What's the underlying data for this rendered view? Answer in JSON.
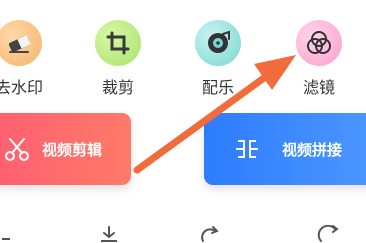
{
  "tools": [
    {
      "label": "去水印",
      "icon": "eraser-icon",
      "color": "#f6b26b"
    },
    {
      "label": "裁剪",
      "icon": "crop-icon",
      "color": "#a6e36b"
    },
    {
      "label": "配乐",
      "icon": "music-disc-icon",
      "color": "#77d7d0"
    },
    {
      "label": "滤镜",
      "icon": "filter-icon",
      "color": "#ff9ccc"
    }
  ],
  "cards": {
    "edit": {
      "label": "视频剪辑",
      "icon": "scissors-icon",
      "color": "#ff6a6d"
    },
    "join": {
      "label": "视频拼接",
      "icon": "join-icon",
      "color": "#3a86ff"
    }
  },
  "annotation": {
    "type": "arrow",
    "color": "#f26b3a"
  }
}
